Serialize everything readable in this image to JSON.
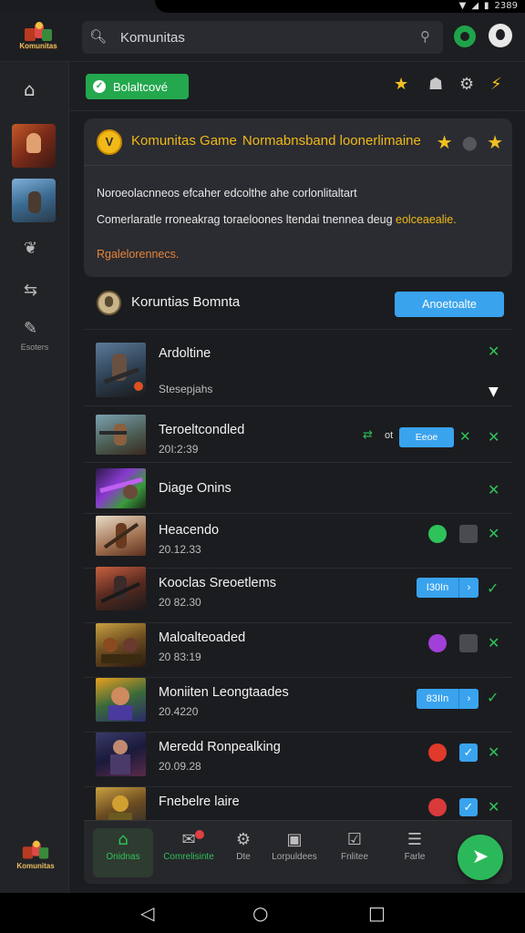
{
  "status_bar": {
    "time": "2389",
    "icons": [
      "wifi-icon",
      "signal-icon",
      "battery-icon"
    ]
  },
  "app": {
    "logo_text": "Komunitas"
  },
  "search": {
    "value": "Komunitas"
  },
  "sidebar": {
    "label": "Esoters",
    "logo_text": "Komunitas"
  },
  "header": {
    "green_button": "Bolaltcové"
  },
  "announcement": {
    "title": "Komunitas Game",
    "title_suffix": "Normabnsband loonerlimaine",
    "line1": "Noroeolacnneos efcaher edcolthe ahe corlonlitaltart",
    "line2": "Comerlaratle rroneakrag toraeloones ltendai tnennea deug",
    "line2_highlight": "eolceaealie.",
    "line3": "Rgalelorennecs."
  },
  "community": {
    "title": "Koruntias Bomnta",
    "button": "Anoetoalte"
  },
  "list": [
    {
      "title": "Ardoltine",
      "sub": "Stesepjahs"
    },
    {
      "title": "Teroeltcondled",
      "sub": "20I:2:39",
      "button": "Eeoe",
      "prefix": "ot"
    },
    {
      "title": "Diage Onins",
      "sub": ""
    },
    {
      "title": "Heacendo",
      "sub": "20.12.33"
    },
    {
      "title": "Kooclas Sreoetlems",
      "sub": "20 82.30",
      "button": "I30In"
    },
    {
      "title": "Maloalteoaded",
      "sub": "20 83:19"
    },
    {
      "title": "Moniiten Leongtaades",
      "sub": "20.4220",
      "button": "83IIn"
    },
    {
      "title": "Meredd Ronpealking",
      "sub": "20.09.28"
    },
    {
      "title": "Fnebelre laire",
      "sub": ""
    }
  ],
  "bottom_nav": [
    {
      "label": "Onidnas",
      "icon": "home-icon"
    },
    {
      "label": "Comrelisinte",
      "icon": "comment-icon"
    },
    {
      "label": "Dte",
      "icon": "gear-icon"
    },
    {
      "label": "Lorpuldees",
      "icon": "camera-icon"
    },
    {
      "label": "Fnlitee",
      "icon": "check-icon"
    },
    {
      "label": "Farle",
      "icon": "menu-icon"
    }
  ],
  "colors": {
    "accent_green": "#2fc25a",
    "accent_blue": "#3aa3ee",
    "accent_gold": "#f0b818",
    "background": "#1b1c1f"
  }
}
